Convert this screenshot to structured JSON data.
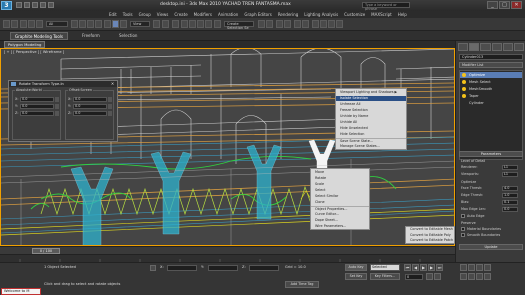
{
  "window": {
    "logo": "3",
    "title": "desktop.ini - 3ds Max 2010     YACHAD TREN FANTASMA.max",
    "search_placeholder": "Type a keyword or phrase",
    "min_label": "_",
    "max_label": "□",
    "close_label": "✕"
  },
  "menu": [
    "Edit",
    "Tools",
    "Group",
    "Views",
    "Create",
    "Modifiers",
    "Animation",
    "Graph Editors",
    "Rendering",
    "Lighting Analysis",
    "Customize",
    "MAXScript",
    "Help"
  ],
  "toolbar": {
    "selection_filter": "All",
    "ref_coord": "View",
    "named_sel": "Create Selection Se"
  },
  "ribbon": {
    "tabs": [
      "Graphite Modeling Tools",
      "Freeform",
      "Selection"
    ],
    "sub_tab": "Polygon Modeling"
  },
  "viewport": {
    "label": "[ + ] [ Perspective ] [ Wireframe ]"
  },
  "dialog": {
    "title": "Rotate Transform Type-In",
    "close": "✕",
    "absolute": {
      "title": "Absolute:World",
      "rows": [
        {
          "axis": "X:",
          "value": "0.0"
        },
        {
          "axis": "Y:",
          "value": "0.0"
        },
        {
          "axis": "Z:",
          "value": "0.0"
        }
      ]
    },
    "offset": {
      "title": "Offset:Screen",
      "rows": [
        {
          "axis": "X:",
          "value": "0.0"
        },
        {
          "axis": "Y:",
          "value": "0.0"
        },
        {
          "axis": "Z:",
          "value": "0.0"
        }
      ]
    }
  },
  "quad_top": [
    "Viewport Lighting and Shadows ▶",
    "Isolate Selection",
    "Unfreeze All",
    "Freeze Selection",
    "Unhide by Name",
    "Unhide All",
    "Hide Unselected",
    "Hide Selection",
    "Save Scene State...",
    "Manage Scene States..."
  ],
  "quad_left": [
    "Move",
    "Rotate",
    "Scale",
    "Select",
    "Select Similar",
    "Clone",
    "Object Properties...",
    "Curve Editor...",
    "Dope Sheet...",
    "Wire Parameters..."
  ],
  "quad_right": [
    "Convert to Editable Mesh",
    "Convert to Editable Poly",
    "Convert to Editable Patch"
  ],
  "cmdpanel": {
    "object_name": "Cylinder013",
    "modifier_list": "Modifier List",
    "stack": [
      "Optimize",
      "Mesh Select",
      "MeshSmooth",
      "Taper",
      "Cylinder"
    ],
    "parameters_header": "Parameters",
    "level_of_detail": "Level of Detail",
    "renderer_label": "Renderer:",
    "renderer_value": "L1",
    "viewports_label": "Viewports:",
    "viewports_value": "L1",
    "optimize_label": "Optimize",
    "face_thresh_label": "Face Thresh:",
    "face_thresh_value": "4.0",
    "edge_thresh_label": "Edge Thresh:",
    "edge_thresh_value": "1.0",
    "bias_label": "Bias:",
    "bias_value": "0.1",
    "max_edge_label": "Max Edge Len:",
    "max_edge_value": "0.0",
    "auto_edge": "Auto Edge",
    "preserve_label": "Preserve",
    "material_boundaries": "Material Boundaries",
    "smooth_boundaries": "Smooth Boundaries",
    "update_header": "Update"
  },
  "timeslider": {
    "frame": "0 / 100"
  },
  "status": {
    "maxscript": "Welcome to M",
    "selection_text": "1 Object Selected",
    "prompt_text": "Click and drag to select and rotate objects",
    "x_label": "X:",
    "x_value": "",
    "y_label": "Y:",
    "y_value": "",
    "z_label": "Z:",
    "z_value": "",
    "grid": "Grid = 10.0",
    "add_time_tag": "Add Time Tag",
    "auto_key": "Auto Key",
    "set_key": "Set Key",
    "key_filter_value": "Selected",
    "key_filters": "Key Filters...",
    "frame_field": "0"
  }
}
